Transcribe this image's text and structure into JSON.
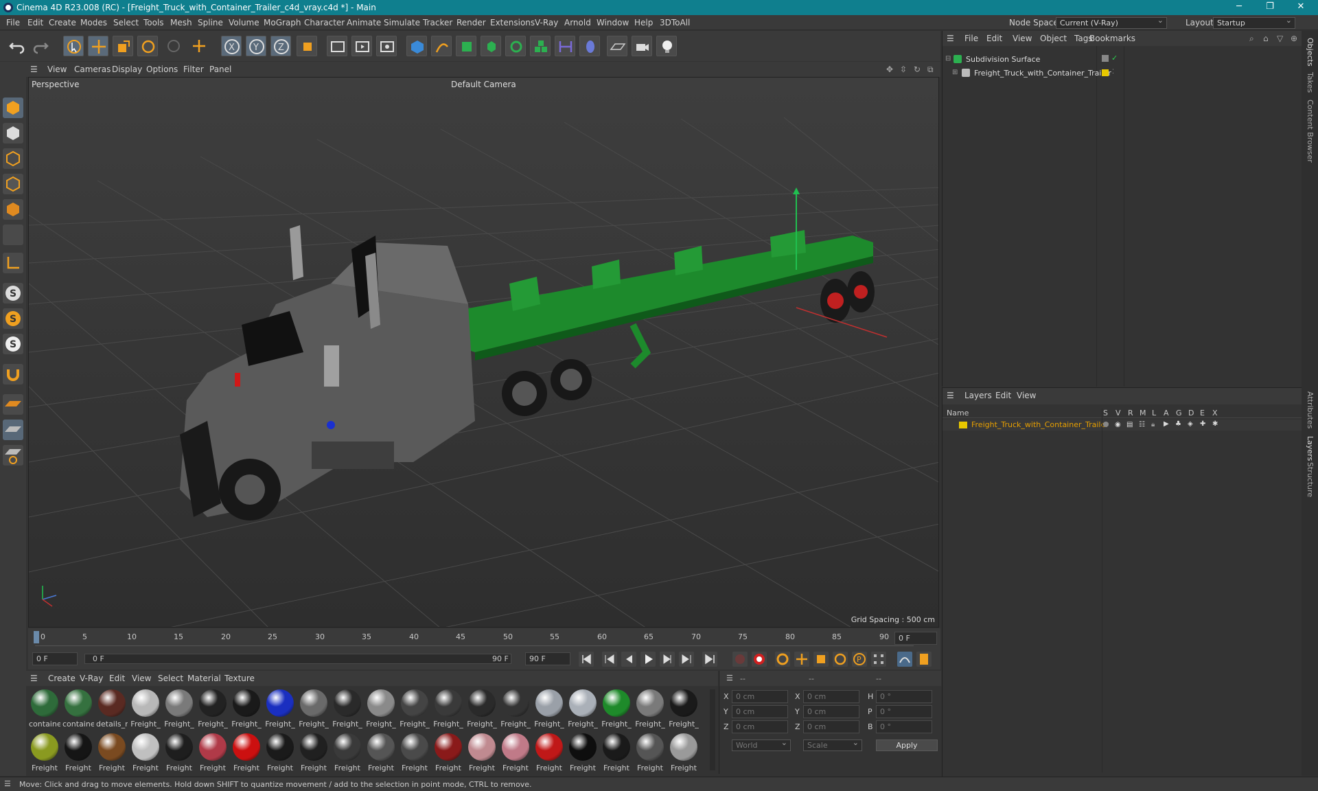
{
  "window": {
    "title": "Cinema 4D R23.008 (RC) - [Freight_Truck_with_Container_Trailer_c4d_vray.c4d *] - Main"
  },
  "menubar": {
    "items": [
      "File",
      "Edit",
      "Create",
      "Modes",
      "Select",
      "Tools",
      "Mesh",
      "Spline",
      "Volume",
      "MoGraph",
      "Character",
      "Animate",
      "Simulate",
      "Tracker",
      "Render",
      "Extensions",
      "V-Ray",
      "Arnold",
      "Window",
      "Help",
      "3DToAll"
    ],
    "node_space_label": "Node Space:",
    "node_space_value": "Current (V-Ray)",
    "layout_label": "Layout:",
    "layout_value": "Startup"
  },
  "viewport": {
    "menu": [
      "View",
      "Cameras",
      "Display",
      "Options",
      "Filter",
      "Panel"
    ],
    "label": "Perspective",
    "camera": "Default Camera",
    "grid_spacing": "Grid Spacing : 500 cm"
  },
  "timeline": {
    "ticks": [
      "0",
      "5",
      "10",
      "15",
      "20",
      "25",
      "30",
      "35",
      "40",
      "45",
      "50",
      "55",
      "60",
      "65",
      "70",
      "75",
      "80",
      "85",
      "90"
    ],
    "current_frame": "0 F"
  },
  "transport": {
    "start": "0 F",
    "range_start": "0 F",
    "range_end": "90 F",
    "end": "90 F"
  },
  "materials": {
    "menu": [
      "Create",
      "V-Ray",
      "Edit",
      "View",
      "Select",
      "Material",
      "Texture"
    ],
    "row1": [
      {
        "name": "containe",
        "color": "#2e6b3a"
      },
      {
        "name": "containe",
        "color": "#35713f"
      },
      {
        "name": "details_r",
        "color": "#5a2a22"
      },
      {
        "name": "Freight_",
        "color": "#b8b8b8"
      },
      {
        "name": "Freight_",
        "color": "#7a7a7a"
      },
      {
        "name": "Freight_",
        "color": "#222222"
      },
      {
        "name": "Freight_",
        "color": "#1a1a1a"
      },
      {
        "name": "Freight_",
        "color": "#1a2fc0"
      },
      {
        "name": "Freight_",
        "color": "#6a6a6a"
      },
      {
        "name": "Freight_",
        "color": "#2a2a2a"
      },
      {
        "name": "Freight_",
        "color": "#8a8a8a"
      },
      {
        "name": "Freight_",
        "color": "#444444"
      },
      {
        "name": "Freight_",
        "color": "#3a3a3a"
      },
      {
        "name": "Freight_",
        "color": "#2a2a2a"
      },
      {
        "name": "Freight_",
        "color": "#333333"
      },
      {
        "name": "Freight_",
        "color": "#9aa0a8"
      },
      {
        "name": "Freight_",
        "color": "#aab0b8"
      },
      {
        "name": "Freight_",
        "color": "#1e8a2a"
      },
      {
        "name": "Freight_",
        "color": "#7a7a7a"
      },
      {
        "name": "Freight_",
        "color": "#1a1a1a"
      }
    ],
    "row2": [
      {
        "name": "Freight",
        "color": "#8a9a20"
      },
      {
        "name": "Freight",
        "color": "#151515"
      },
      {
        "name": "Freight",
        "color": "#7a4a20"
      },
      {
        "name": "Freight",
        "color": "#c0c0c0"
      },
      {
        "name": "Freight",
        "color": "#1e1e1e"
      },
      {
        "name": "Freight",
        "color": "#b03a48"
      },
      {
        "name": "Freight",
        "color": "#cc1010"
      },
      {
        "name": "Freight",
        "color": "#1a1a1a"
      },
      {
        "name": "Freight",
        "color": "#202020"
      },
      {
        "name": "Freight",
        "color": "#3a3a3a"
      },
      {
        "name": "Freight",
        "color": "#555555"
      },
      {
        "name": "Freight",
        "color": "#4a4a4a"
      },
      {
        "name": "Freight",
        "color": "#8a1a1a"
      },
      {
        "name": "Freight",
        "color": "#c08a90"
      },
      {
        "name": "Freight",
        "color": "#c07a88"
      },
      {
        "name": "Freight",
        "color": "#c01818"
      },
      {
        "name": "Freight",
        "color": "#0e0e0e"
      },
      {
        "name": "Freight",
        "color": "#1a1a1a"
      },
      {
        "name": "Freight",
        "color": "#555555"
      },
      {
        "name": "Freight",
        "color": "#9a9a9a"
      }
    ]
  },
  "attributes": {
    "headers": [
      "--",
      "--",
      "--"
    ],
    "rows": [
      {
        "a": "X",
        "av": "0 cm",
        "b": "X",
        "bv": "0 cm",
        "c": "H",
        "cv": "0 °"
      },
      {
        "a": "Y",
        "av": "0 cm",
        "b": "Y",
        "bv": "0 cm",
        "c": "P",
        "cv": "0 °"
      },
      {
        "a": "Z",
        "av": "0 cm",
        "b": "Z",
        "bv": "0 cm",
        "c": "B",
        "cv": "0 °"
      }
    ],
    "coord_mode": "World",
    "size_mode": "Scale",
    "apply": "Apply"
  },
  "objects": {
    "menu": [
      "File",
      "Edit",
      "View",
      "Object",
      "Tags",
      "Bookmarks"
    ],
    "tree": [
      {
        "name": "Subdivision Surface"
      },
      {
        "name": "Freight_Truck_with_Container_Trailer"
      }
    ]
  },
  "layers": {
    "menu": [
      "Layers",
      "Edit",
      "View"
    ],
    "name_header": "Name",
    "col_headers": [
      "S",
      "V",
      "R",
      "M",
      "L",
      "A",
      "G",
      "D",
      "E",
      "X"
    ],
    "rows": [
      {
        "name": "Freight_Truck_with_Container_Trailer",
        "color": "#e8c800"
      }
    ]
  },
  "side_tabs": [
    "Objects",
    "Takes",
    "Content Browser",
    "Attributes",
    "Layers",
    "Structure"
  ],
  "status": "Move: Click and drag to move elements. Hold down SHIFT to quantize movement / add to the selection in point mode, CTRL to remove."
}
